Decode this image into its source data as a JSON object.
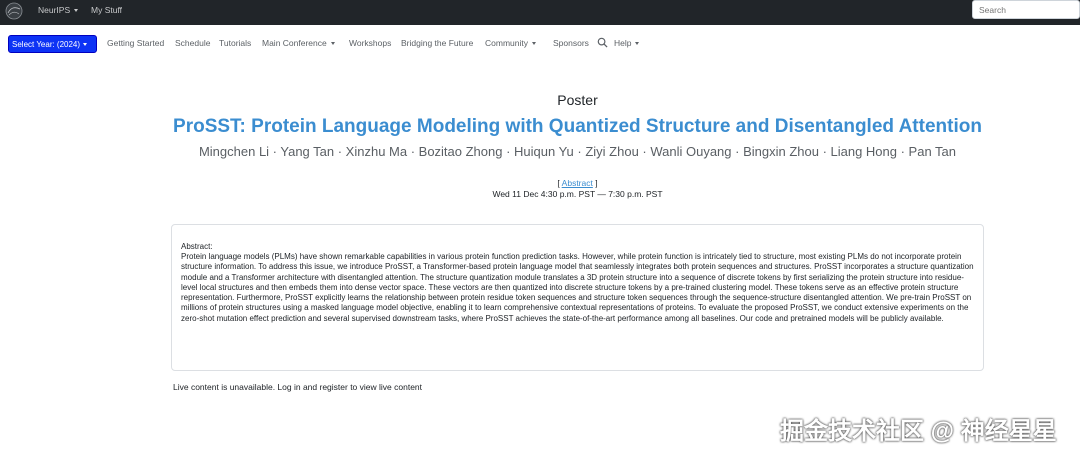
{
  "topbar": {
    "logo_alt": "NeurIPS",
    "menu_label": "NeurIPS",
    "my_stuff_label": "My Stuff",
    "search_placeholder": "Search"
  },
  "nav": {
    "year_select": "Select Year: (2024)",
    "items": {
      "getting_started": "Getting Started",
      "schedule": "Schedule",
      "tutorials": "Tutorials",
      "main_conference": "Main Conference",
      "workshops": "Workshops",
      "bridging": "Bridging the Future",
      "community": "Community",
      "sponsors": "Sponsors",
      "help": "Help"
    }
  },
  "poster": {
    "type_label": "Poster",
    "title": "ProSST: Protein Language Modeling with Quantized Structure and Disentangled Attention",
    "authors": "Mingchen Li · Yang Tan · Xinzhu Ma · Bozitao Zhong · Huiqun Yu · Ziyi Zhou · Wanli Ouyang · Bingxin Zhou · Liang Hong · Pan Tan",
    "abstract_link": "Abstract",
    "datetime": "Wed 11 Dec 4:30 p.m. PST — 7:30 p.m. PST"
  },
  "abstract": {
    "label": "Abstract:",
    "text": "Protein language models (PLMs) have shown remarkable capabilities in various protein function prediction tasks. However, while protein function is intricately tied to structure, most existing PLMs do not incorporate protein structure information. To address this issue, we introduce ProSST, a Transformer-based protein language model that seamlessly integrates both protein sequences and structures. ProSST incorporates a structure quantization module and a Transformer architecture with disentangled attention. The structure quantization module translates a 3D protein structure into a sequence of discrete tokens by first serializing the protein structure into residue-level local structures and then embeds them into dense vector space. These vectors are then quantized into discrete structure tokens by a pre-trained clustering model. These tokens serve as an effective protein structure representation. Furthermore, ProSST explicitly learns the relationship between protein residue token sequences and structure token sequences through the sequence-structure disentangled attention. We pre-train ProSST on millions of protein structures using a masked language model objective, enabling it to learn comprehensive contextual representations of proteins. To evaluate the proposed ProSST, we conduct extensive experiments on the zero-shot mutation effect prediction and several supervised downstream tasks, where ProSST achieves the state-of-the-art performance among all baselines. Our code and pretrained models will be publicly available."
  },
  "live_note": "Live content is unavailable. Log in and register to view live content",
  "watermark": "掘金技术社区 @ 神经星星",
  "colors": {
    "navbar_bg": "#212529",
    "year_button": "#0d33f5",
    "title_blue": "#3b8dd0"
  }
}
